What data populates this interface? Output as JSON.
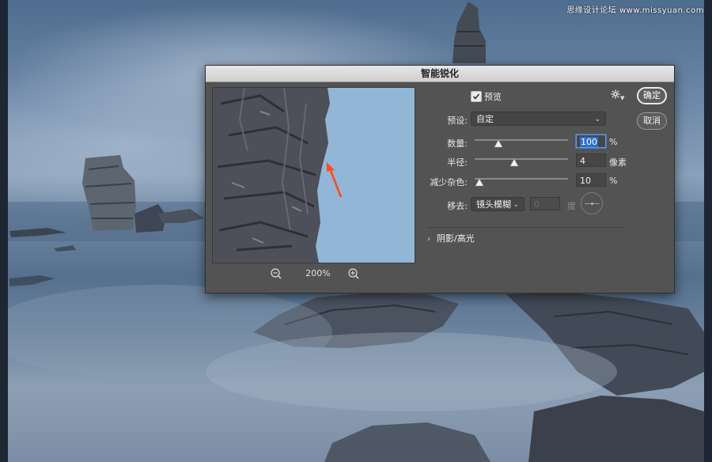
{
  "watermark": "思缘设计论坛 www.missyuan.com",
  "dialog": {
    "title": "智能锐化",
    "preview_checkbox": {
      "label": "预览",
      "checked": true
    },
    "gear_icon": "gear-icon",
    "buttons": {
      "ok": "确定",
      "cancel": "取消"
    },
    "preset": {
      "label": "预设:",
      "value": "自定"
    },
    "amount": {
      "label": "数量:",
      "value": "100",
      "unit": "%",
      "slider_fraction": 0.25
    },
    "radius": {
      "label": "半径:",
      "value": "4",
      "unit": "像素",
      "slider_fraction": 0.42
    },
    "reduce_noise": {
      "label": "减少杂色:",
      "value": "10",
      "unit": "%",
      "slider_fraction": 0.05
    },
    "remove": {
      "label": "移去:",
      "value": "镜头模糊",
      "angle_value": "0",
      "angle_unit": "度"
    },
    "shadows_highlights": {
      "label": "阴影/高光",
      "expanded": false
    },
    "zoom": {
      "value": "200%"
    }
  },
  "colors": {
    "dialog_bg": "#535353",
    "titlebar": "#dcdcdc",
    "focus_blue": "#2f6fd1",
    "annotation_arrow": "#ff4a1c"
  }
}
